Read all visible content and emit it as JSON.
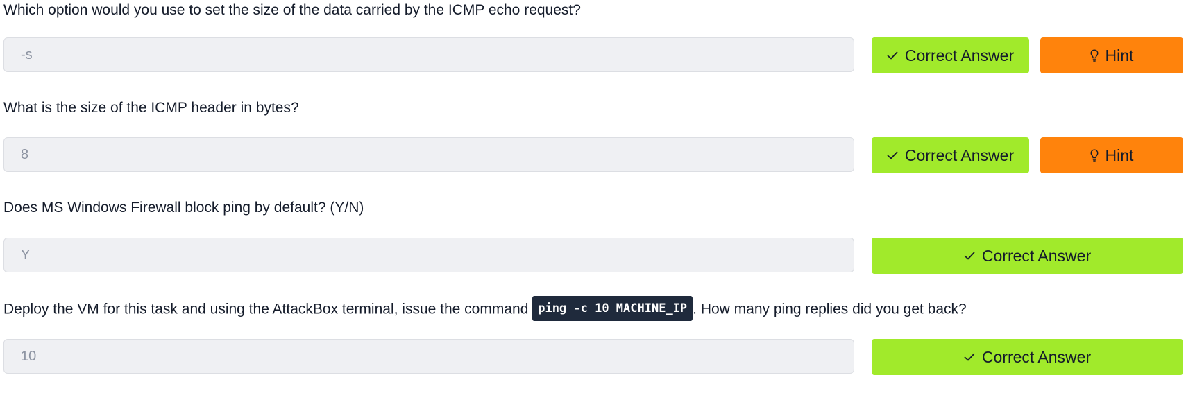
{
  "questions": [
    {
      "text": "Which option would you use to set the size of the data carried by the ICMP echo request?",
      "answer": "-s",
      "correct_label": "Correct Answer",
      "hint_label": "Hint"
    },
    {
      "text": "What is the size of the ICMP header in bytes?",
      "answer": "8",
      "correct_label": "Correct Answer",
      "hint_label": "Hint"
    },
    {
      "text": "Does MS Windows Firewall block ping by default? (Y/N)",
      "answer": "Y",
      "correct_label": "Correct Answer"
    },
    {
      "text_before": "Deploy the VM for this task and using the AttackBox terminal, issue the command ",
      "code": "ping -c 10 MACHINE_IP",
      "text_after": ". How many ping replies did you get back?",
      "answer": "10",
      "correct_label": "Correct Answer"
    }
  ],
  "icons": {
    "correct": "check-icon",
    "hint": "lightbulb-icon"
  },
  "colors": {
    "correct_bg": "#a1ea2b",
    "hint_bg": "#ff830c",
    "input_bg": "#eff0f3",
    "code_bg": "#1f2a3c",
    "text": "#151c2b"
  }
}
